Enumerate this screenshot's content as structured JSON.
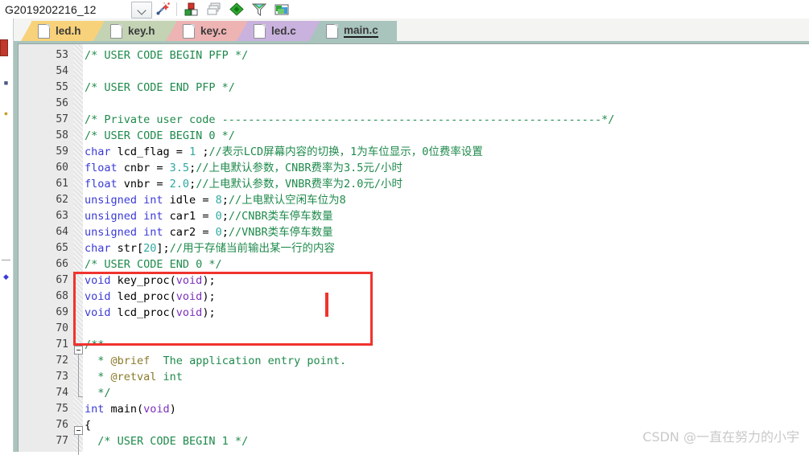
{
  "toolbar": {
    "project_combo_value": "G2019202216_12",
    "dropdown_icon": "chevron-down-icon",
    "icons": [
      {
        "name": "magic-wand-icon",
        "title": "Quick Fix"
      },
      {
        "name": "build-blocks-icon",
        "title": "Build"
      },
      {
        "name": "stacked-windows-icon",
        "title": "Windows"
      },
      {
        "name": "green-diamond-icon",
        "title": "Debug"
      },
      {
        "name": "funnel-filter-icon",
        "title": "Filter"
      },
      {
        "name": "green-box-icon",
        "title": "Package"
      }
    ]
  },
  "left_strip": {
    "red_tab_name": "red-marker-tab",
    "glyphs": [
      "panel-glyph-a",
      "panel-glyph-b",
      "panel-glyph-c"
    ]
  },
  "tabs": [
    {
      "label": "led.h",
      "color": "#f8d27a",
      "active": false,
      "icon": "file-icon"
    },
    {
      "label": "key.h",
      "color": "#c3d3b4",
      "active": false,
      "icon": "file-icon"
    },
    {
      "label": "key.c",
      "color": "#eeb3b3",
      "active": false,
      "icon": "file-icon"
    },
    {
      "label": "led.c",
      "color": "#c9b2dd",
      "active": false,
      "icon": "file-icon"
    },
    {
      "label": "main.c",
      "color": "#a8c4bd",
      "active": true,
      "icon": "file-icon"
    }
  ],
  "editor": {
    "first_line": 53,
    "lines": [
      {
        "n": 53,
        "segs": [
          {
            "t": "/* USER CODE BEGIN PFP */",
            "c": "cm"
          }
        ]
      },
      {
        "n": 54,
        "segs": []
      },
      {
        "n": 55,
        "segs": [
          {
            "t": "/* USER CODE END PFP */",
            "c": "cm"
          }
        ]
      },
      {
        "n": 56,
        "segs": []
      },
      {
        "n": 57,
        "segs": [
          {
            "t": "/* Private user code ----------------------------------------------------------*/",
            "c": "cm"
          }
        ]
      },
      {
        "n": 58,
        "segs": [
          {
            "t": "/* USER CODE BEGIN 0 */",
            "c": "cm"
          }
        ]
      },
      {
        "n": 59,
        "segs": [
          {
            "t": "char",
            "c": "kw"
          },
          {
            "t": " lcd_flag = ",
            "c": "pl"
          },
          {
            "t": "1",
            "c": "num"
          },
          {
            "t": " ;",
            "c": "pl"
          },
          {
            "t": "//表示LCD屏幕内容的切换，1为车位显示，0位费率设置",
            "c": "cm"
          }
        ]
      },
      {
        "n": 60,
        "segs": [
          {
            "t": "float",
            "c": "kw"
          },
          {
            "t": " cnbr = ",
            "c": "pl"
          },
          {
            "t": "3.5",
            "c": "num"
          },
          {
            "t": ";",
            "c": "pl"
          },
          {
            "t": "//上电默认参数，CNBR费率为3.5元/小时",
            "c": "cm"
          }
        ]
      },
      {
        "n": 61,
        "segs": [
          {
            "t": "float",
            "c": "kw"
          },
          {
            "t": " vnbr = ",
            "c": "pl"
          },
          {
            "t": "2.0",
            "c": "num"
          },
          {
            "t": ";",
            "c": "pl"
          },
          {
            "t": "//上电默认参数，VNBR费率为2.0元/小时",
            "c": "cm"
          }
        ]
      },
      {
        "n": 62,
        "segs": [
          {
            "t": "unsigned int",
            "c": "kw"
          },
          {
            "t": " idle = ",
            "c": "pl"
          },
          {
            "t": "8",
            "c": "num"
          },
          {
            "t": ";",
            "c": "pl"
          },
          {
            "t": "//上电默认空闲车位为8",
            "c": "cm"
          }
        ]
      },
      {
        "n": 63,
        "segs": [
          {
            "t": "unsigned int",
            "c": "kw"
          },
          {
            "t": " car1 = ",
            "c": "pl"
          },
          {
            "t": "0",
            "c": "num"
          },
          {
            "t": ";",
            "c": "pl"
          },
          {
            "t": "//CNBR类车停车数量",
            "c": "cm"
          }
        ]
      },
      {
        "n": 64,
        "segs": [
          {
            "t": "unsigned int",
            "c": "kw"
          },
          {
            "t": " car2 = ",
            "c": "pl"
          },
          {
            "t": "0",
            "c": "num"
          },
          {
            "t": ";",
            "c": "pl"
          },
          {
            "t": "//VNBR类车停车数量",
            "c": "cm"
          }
        ]
      },
      {
        "n": 65,
        "segs": [
          {
            "t": "char",
            "c": "kw"
          },
          {
            "t": " str[",
            "c": "pl"
          },
          {
            "t": "20",
            "c": "num"
          },
          {
            "t": "];",
            "c": "pl"
          },
          {
            "t": "//用于存储当前输出某一行的内容",
            "c": "cm"
          }
        ]
      },
      {
        "n": 66,
        "segs": [
          {
            "t": "/* USER CODE END 0 */",
            "c": "cm"
          }
        ]
      },
      {
        "n": 67,
        "segs": [
          {
            "t": "void",
            "c": "kw"
          },
          {
            "t": " key_proc(",
            "c": "pl"
          },
          {
            "t": "void",
            "c": "kw2"
          },
          {
            "t": ");",
            "c": "pl"
          }
        ]
      },
      {
        "n": 68,
        "segs": [
          {
            "t": "void",
            "c": "kw"
          },
          {
            "t": " led_proc(",
            "c": "pl"
          },
          {
            "t": "void",
            "c": "kw2"
          },
          {
            "t": ");",
            "c": "pl"
          }
        ]
      },
      {
        "n": 69,
        "segs": [
          {
            "t": "void",
            "c": "kw"
          },
          {
            "t": " lcd_proc(",
            "c": "pl"
          },
          {
            "t": "void",
            "c": "kw2"
          },
          {
            "t": ");",
            "c": "pl"
          }
        ]
      },
      {
        "n": 70,
        "segs": []
      },
      {
        "n": 71,
        "segs": [
          {
            "t": "/**",
            "c": "cm"
          }
        ]
      },
      {
        "n": 72,
        "segs": [
          {
            "t": "  * ",
            "c": "cm"
          },
          {
            "t": "@brief",
            "c": "doc"
          },
          {
            "t": "  The application entry point.",
            "c": "cm"
          }
        ]
      },
      {
        "n": 73,
        "segs": [
          {
            "t": "  * ",
            "c": "cm"
          },
          {
            "t": "@retval",
            "c": "doc"
          },
          {
            "t": " int",
            "c": "cm"
          }
        ]
      },
      {
        "n": 74,
        "segs": [
          {
            "t": "  */",
            "c": "cm"
          }
        ]
      },
      {
        "n": 75,
        "segs": [
          {
            "t": "int",
            "c": "kw"
          },
          {
            "t": " main(",
            "c": "pl"
          },
          {
            "t": "void",
            "c": "kw2"
          },
          {
            "t": ")",
            "c": "pl"
          }
        ]
      },
      {
        "n": 76,
        "segs": [
          {
            "t": "{",
            "c": "pl"
          }
        ]
      },
      {
        "n": 77,
        "segs": [
          {
            "t": "  /* USER CODE BEGIN 1 */",
            "c": "cm"
          }
        ]
      }
    ],
    "fold_markers": [
      {
        "line": 71,
        "state": "expanded"
      },
      {
        "line": 76,
        "state": "expanded"
      }
    ],
    "annotation": {
      "type": "red-highlight-box",
      "covers_lines": "67-70",
      "caret_visible": true
    }
  },
  "watermark": {
    "text": "CSDN @一直在努力的小宇"
  },
  "colors": {
    "comment": "#1f8a4c",
    "keyword": "#3a3ad6",
    "keyword_alt": "#7b2fbe",
    "number": "#2fa8a0",
    "doc_tag": "#8a7a2a",
    "annotation_red": "#f0332e",
    "active_tab": "#a8c4bd",
    "gutter": "#ebebeb"
  }
}
